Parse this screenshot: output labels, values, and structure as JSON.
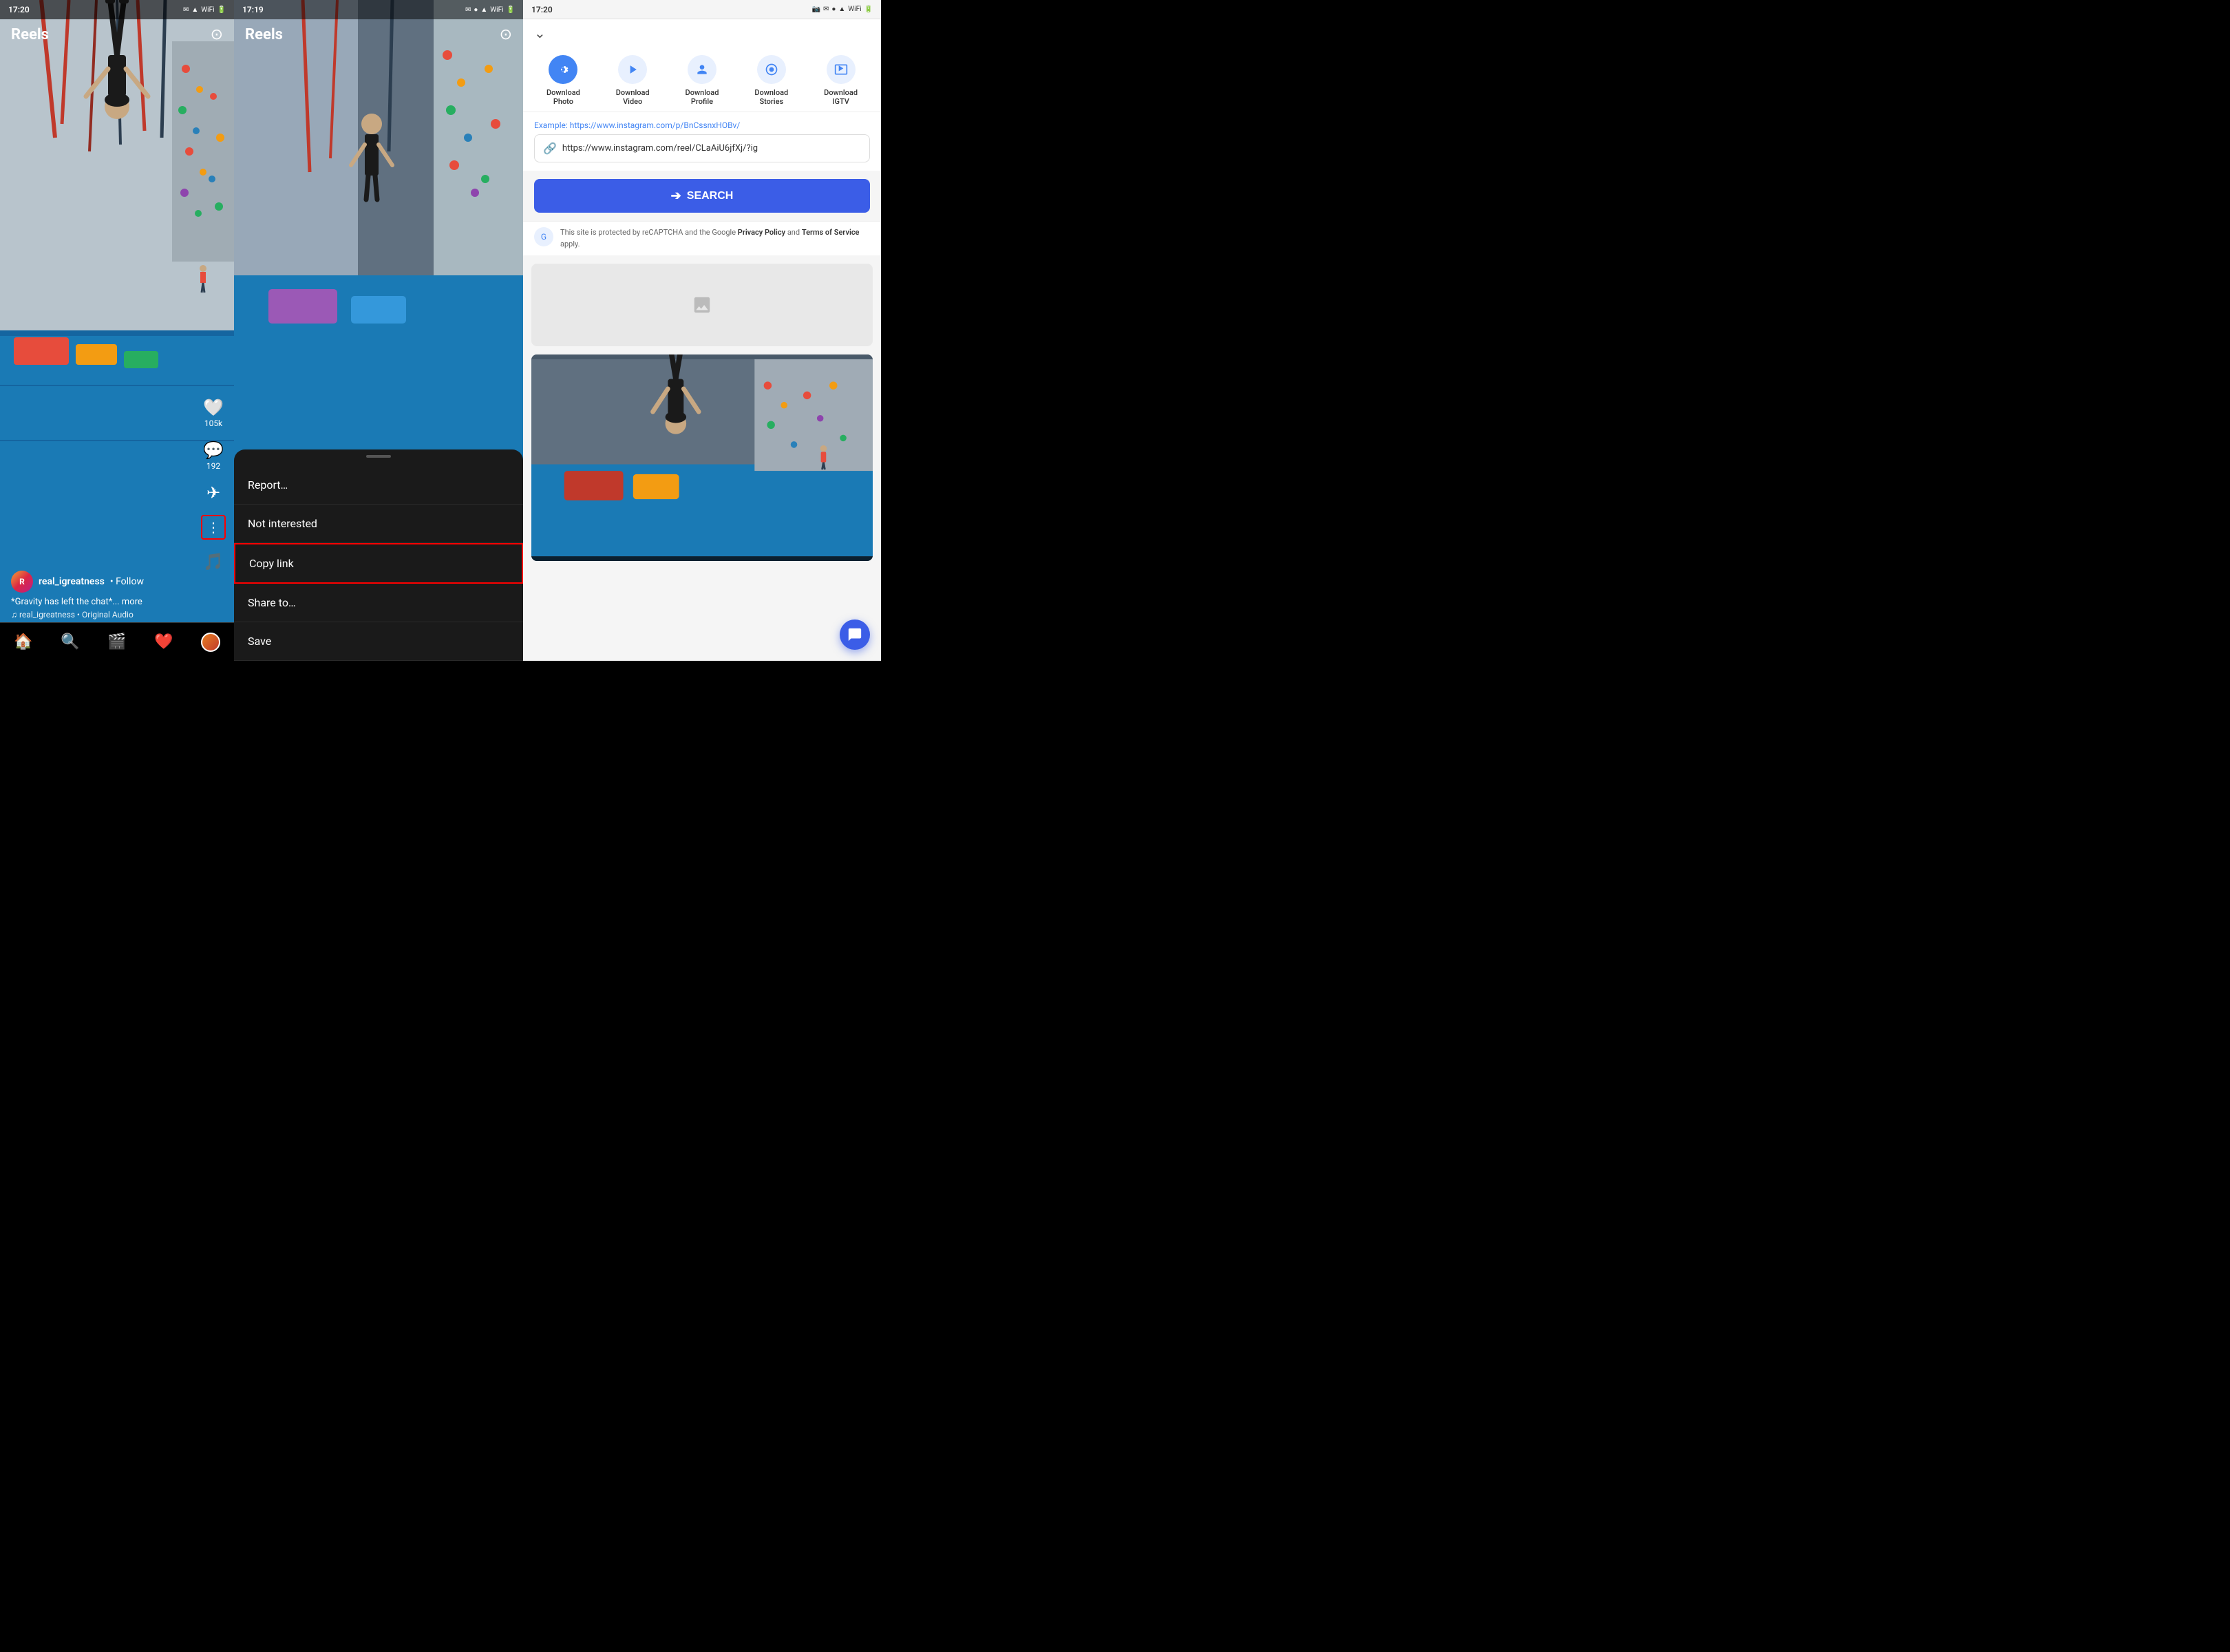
{
  "panel1": {
    "status_time": "17:20",
    "title": "Reels",
    "username": "real_igreatness",
    "follow": "• Follow",
    "caption": "*Gravity has left the chat*... more",
    "audio": "♫ real_igreatness • Original Audio",
    "likes": "105k",
    "comments": "192",
    "nav_items": [
      "🏠",
      "🔍",
      "🎬",
      "❤️"
    ]
  },
  "panel2": {
    "status_time": "17:19",
    "title": "Reels",
    "menu_items": [
      "Report…",
      "Not interested",
      "Copy link",
      "Share to…",
      "Save"
    ]
  },
  "panel3": {
    "status_time": "17:20",
    "download_tabs": [
      {
        "label": "Download\nPhoto",
        "icon": "📷",
        "active": false
      },
      {
        "label": "Download\nVideo",
        "icon": "▶",
        "active": false
      },
      {
        "label": "Download\nProfile",
        "icon": "👤",
        "active": false
      },
      {
        "label": "Download\nStories",
        "icon": "📖",
        "active": false
      },
      {
        "label": "Download\nIGTV",
        "icon": "📺",
        "active": false
      }
    ],
    "example_label": "Example: https://www.instagram.com/p/BnCssnxHOBv/",
    "url_value": "https://www.instagram.com/reel/CLaAiU6jfXj/?ig",
    "search_label": "SEARCH",
    "recaptcha_text": "This site is protected by reCAPTCHA and the Google ",
    "privacy_policy": "Privacy Policy",
    "and": " and ",
    "terms": "Terms of Service",
    "apply": " apply."
  }
}
